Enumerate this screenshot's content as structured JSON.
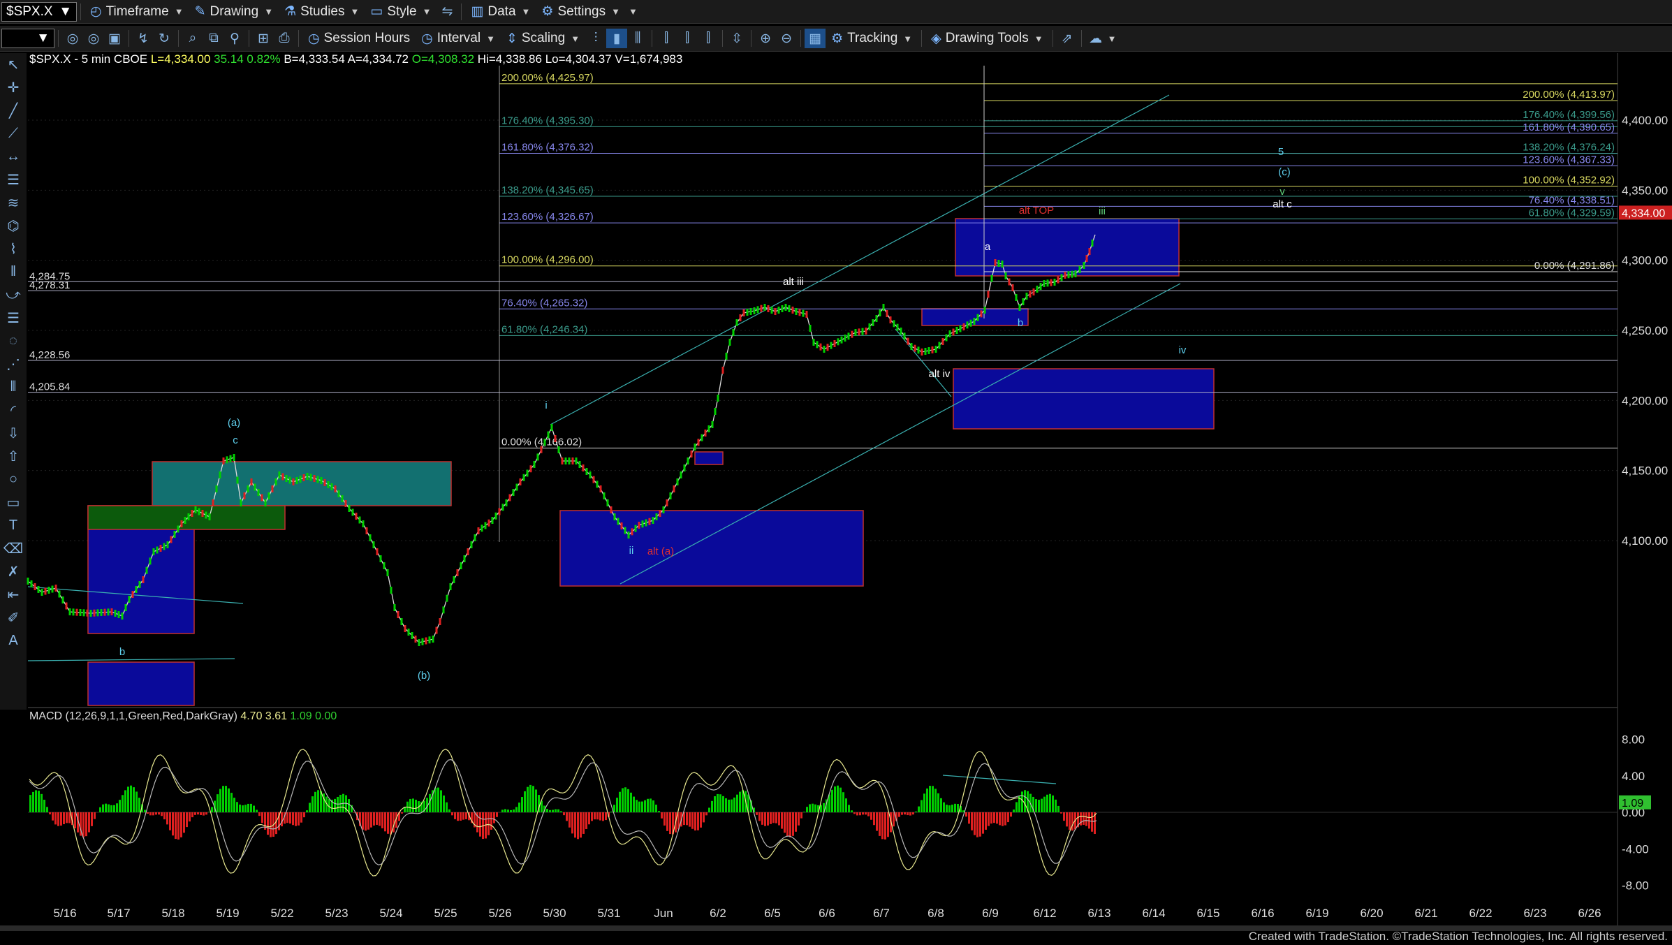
{
  "toolbar1": {
    "symbol": "$SPX.X",
    "timeframe": "Timeframe",
    "drawing": "Drawing",
    "studies": "Studies",
    "style": "Style",
    "data": "Data",
    "settings": "Settings"
  },
  "toolbar2": {
    "session_hours": "Session Hours",
    "interval": "Interval",
    "scaling": "Scaling",
    "tracking": "Tracking",
    "drawing_tools": "Drawing Tools"
  },
  "header": {
    "symbol": "$SPX.X - 5 min",
    "exchange": "CBOE",
    "last": "L=4,334.00",
    "change": "35.14",
    "pct": "0.82%",
    "bid": "B=4,333.54",
    "ask": "A=4,334.72",
    "open": "O=4,308.32",
    "high": "Hi=4,338.86",
    "low": "Lo=4,304.37",
    "volume": "V=1,674,983"
  },
  "price_axis": {
    "ticks": [
      "4,400.00",
      "4,350.00",
      "4,300.00",
      "4,250.00",
      "4,200.00",
      "4,150.00",
      "4,100.00"
    ],
    "last_price": "4,334.00"
  },
  "fib_left": [
    {
      "label": "200.00% (4,425.97)",
      "price": 4425.97,
      "color": "#d8d860"
    },
    {
      "label": "176.40% (4,395.30)",
      "price": 4395.3,
      "color": "#3a9a8a"
    },
    {
      "label": "161.80% (4,376.32)",
      "price": 4376.32,
      "color": "#8888ee"
    },
    {
      "label": "138.20% (4,345.65)",
      "price": 4345.65,
      "color": "#3a9a8a"
    },
    {
      "label": "123.60% (4,326.67)",
      "price": 4326.67,
      "color": "#8888ee"
    },
    {
      "label": "100.00% (4,296.00)",
      "price": 4296.0,
      "color": "#d8d860"
    },
    {
      "label": "76.40% (4,265.32)",
      "price": 4265.32,
      "color": "#8888ee"
    },
    {
      "label": "61.80% (4,246.34)",
      "price": 4246.34,
      "color": "#3a9a8a"
    },
    {
      "label": "0.00% (4,166.02)",
      "price": 4166.02,
      "color": "#dddddd"
    }
  ],
  "fib_right": [
    {
      "label": "200.00% (4,413.97)",
      "price": 4413.97,
      "color": "#d8d860"
    },
    {
      "label": "176.40% (4,399.56)",
      "price": 4399.56,
      "color": "#3a9a8a"
    },
    {
      "label": "161.80% (4,390.65)",
      "price": 4390.65,
      "color": "#8888ee"
    },
    {
      "label": "138.20% (4,376.24)",
      "price": 4376.24,
      "color": "#3a9a8a"
    },
    {
      "label": "123.60% (4,367.33)",
      "price": 4367.33,
      "color": "#8888ee"
    },
    {
      "label": "100.00% (4,352.92)",
      "price": 4352.92,
      "color": "#d8d860"
    },
    {
      "label": "76.40% (4,338.51)",
      "price": 4338.51,
      "color": "#8888ee"
    },
    {
      "label": "61.80% (4,329.59)",
      "price": 4329.59,
      "color": "#3a9a8a"
    },
    {
      "label": "0.00% (4,291.86)",
      "price": 4291.86,
      "color": "#dddddd"
    }
  ],
  "horizontal_levels": [
    {
      "label": "4,284.75",
      "price": 4284.75
    },
    {
      "label": "4,278.31",
      "price": 4278.31
    },
    {
      "label": "4,228.56",
      "price": 4228.56
    },
    {
      "label": "4,205.84",
      "price": 4205.84
    }
  ],
  "wave_labels": [
    {
      "text": "(a)",
      "color": "#5fd0ee"
    },
    {
      "text": "c",
      "color": "#5fd0ee"
    },
    {
      "text": "b",
      "color": "#5fd0ee"
    },
    {
      "text": "(b)",
      "color": "#5fd0ee"
    },
    {
      "text": "i",
      "color": "#5fd0ee"
    },
    {
      "text": "ii",
      "color": "#5fd0ee"
    },
    {
      "text": "alt (a)",
      "color": "#e03030"
    },
    {
      "text": "alt iii",
      "color": "#ffffff"
    },
    {
      "text": "alt iv",
      "color": "#ffffff"
    },
    {
      "text": "a",
      "color": "#ffffff"
    },
    {
      "text": "b",
      "color": "#5fd0ee"
    },
    {
      "text": "alt TOP",
      "color": "#e03030"
    },
    {
      "text": "iii",
      "color": "#5fd07a"
    },
    {
      "text": "iv",
      "color": "#5fd0ee"
    },
    {
      "text": "5",
      "color": "#5fd0ee"
    },
    {
      "text": "(c)",
      "color": "#5fd0ee"
    },
    {
      "text": "v",
      "color": "#5fd07a"
    },
    {
      "text": "alt c",
      "color": "#ffffff"
    }
  ],
  "x_axis": [
    "5/16",
    "5/17",
    "5/18",
    "5/19",
    "5/22",
    "5/23",
    "5/24",
    "5/25",
    "5/26",
    "5/30",
    "5/31",
    "Jun",
    "6/2",
    "6/5",
    "6/6",
    "6/7",
    "6/8",
    "6/9",
    "6/12",
    "6/13",
    "6/14",
    "6/15",
    "6/16",
    "6/19",
    "6/20",
    "6/21",
    "6/22",
    "6/23",
    "6/26"
  ],
  "macd": {
    "title": "MACD (12,26,9,1,1,Green,Red,DarkGray)",
    "v1": "4.70",
    "v2": "3.61",
    "v3": "1.09",
    "v4": "0.00",
    "ticks": [
      "8.00",
      "4.00",
      "0.00",
      "-4.00",
      "-8.00"
    ],
    "last": "1.09"
  },
  "colors": {
    "up": "#00d000",
    "down": "#e02020",
    "accent": "#1d4f8a"
  },
  "footer": "Created with TradeStation. ©TradeStation Technologies, Inc. All rights reserved."
}
